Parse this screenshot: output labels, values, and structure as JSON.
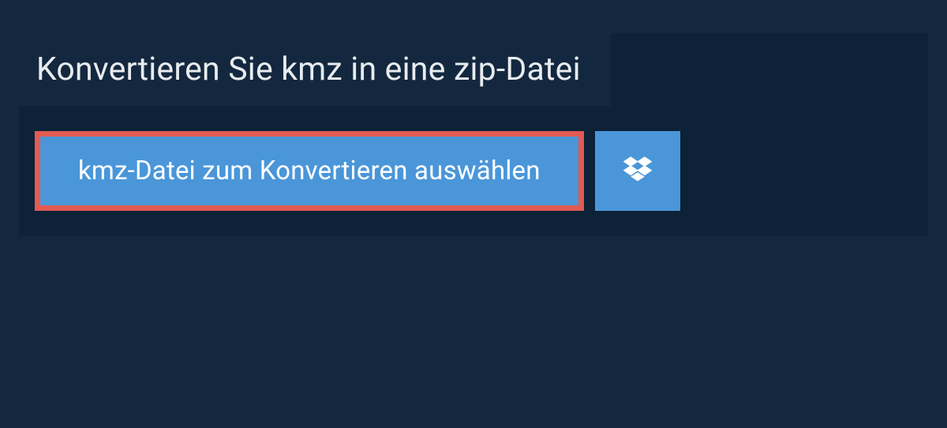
{
  "header": {
    "title": "Konvertieren Sie kmz in eine zip-Datei"
  },
  "actions": {
    "select_file_label": "kmz-Datei zum Konvertieren auswählen"
  },
  "colors": {
    "page_bg": "#13283f",
    "panel_bg": "#0d2137",
    "button_bg": "#4a96d9",
    "highlight_border": "#e15b52",
    "text_light": "#e8ecef"
  }
}
